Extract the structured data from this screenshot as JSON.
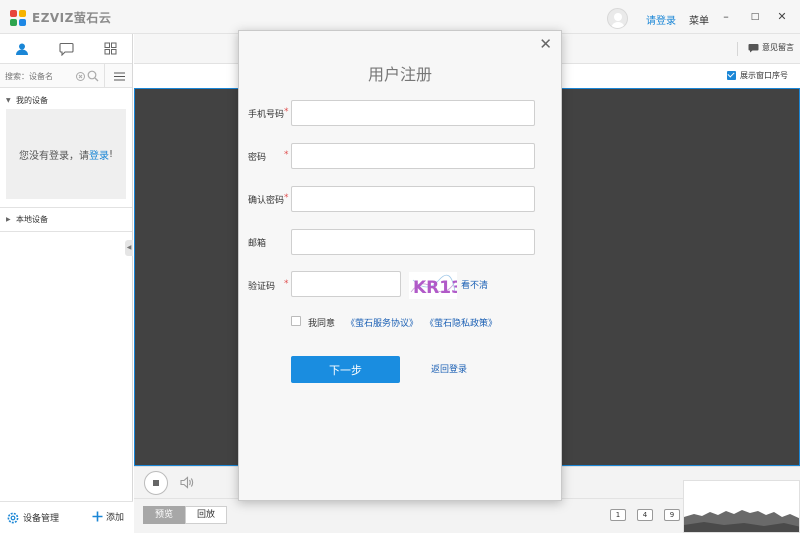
{
  "app": {
    "brand": "EZVIZ萤石云",
    "login_link": "请登录",
    "menu": "菜单",
    "minimize": "–",
    "maximize": "□",
    "close": "✕"
  },
  "left_panel": {
    "search_placeholder": "搜索：设备名",
    "my_devices": "我的设备",
    "not_logged_prefix": "您没有登录，请",
    "not_logged_link": "登录",
    "not_logged_suffix": "!",
    "local_devices": "本地设备",
    "device_manage": "设备管理",
    "add": "添加"
  },
  "toolbar": {
    "feedback": "意见留言",
    "show_window_no": "展示窗口序号"
  },
  "bottom": {
    "preview": "预览",
    "playback": "回放",
    "layouts": [
      "1",
      "4",
      "9"
    ]
  },
  "register": {
    "title": "用户注册",
    "phone_label": "手机号码",
    "password_label": "密码",
    "confirm_label": "确认密码",
    "email_label": "邮箱",
    "captcha_label": "验证码",
    "required_mark": "*",
    "captcha_text": "KR13",
    "cant_see": "看不清",
    "agree": "我同意",
    "service_agreement": "《萤石服务协议》",
    "privacy_policy": "《萤石隐私政策》",
    "next": "下一步",
    "back_login": "返回登录",
    "close": "✕"
  },
  "colors": {
    "accent": "#1a86d6",
    "video_bg": "#424242",
    "logo": [
      "#e8453c",
      "#f6b300",
      "#2ea44f",
      "#1e88e5"
    ]
  }
}
